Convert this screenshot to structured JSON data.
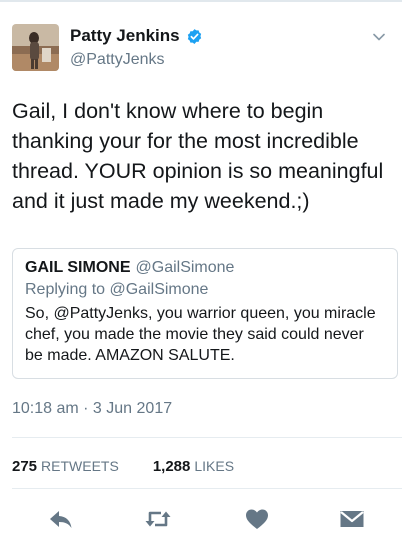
{
  "tweet": {
    "author": {
      "display_name": "Patty Jenkins",
      "handle": "@PattyJenks",
      "verified": true
    },
    "text": "Gail, I don't know where to begin thanking your for the most incredible thread. YOUR opinion is so meaningful and it just made my weekend.;)",
    "quoted": {
      "name": "GAIL SIMONE",
      "handle": "@GailSimone",
      "replying_to": "Replying to @GailSimone",
      "text": "So, @PattyJenks, you warrior queen, you miracle chef, you made the movie they said could never be made. AMAZON SALUTE."
    },
    "timestamp": "10:18 am · 3 Jun 2017",
    "stats": {
      "retweets_count": "275",
      "retweets_label": "RETWEETS",
      "likes_count": "1,288",
      "likes_label": "LIKES"
    }
  },
  "icons": {
    "verified": "verified-badge-icon",
    "caret": "chevron-down-icon",
    "reply": "reply-icon",
    "retweet": "retweet-icon",
    "like": "heart-icon",
    "dm": "envelope-icon"
  },
  "colors": {
    "verified_blue": "#1da1f2",
    "icon_gray": "#657786",
    "text_primary": "#14171a",
    "text_secondary": "#657786"
  }
}
